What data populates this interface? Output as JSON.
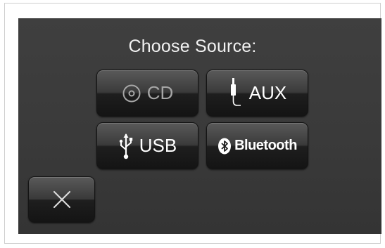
{
  "title": "Choose Source:",
  "sources": {
    "cd": {
      "label": "CD",
      "icon": "disc-icon",
      "enabled": false
    },
    "aux": {
      "label": "AUX",
      "icon": "aux-jack-icon",
      "enabled": true
    },
    "usb": {
      "label": "USB",
      "icon": "usb-icon",
      "enabled": true
    },
    "bluetooth": {
      "label": "Bluetooth",
      "icon": "bluetooth-icon",
      "enabled": true
    }
  },
  "close": {
    "icon": "close-icon"
  },
  "colors": {
    "screen_bg": "#3a3a3a",
    "button_bg": "#2a2a2a",
    "text": "#ffffff",
    "disabled_text": "#a6a6a6"
  }
}
